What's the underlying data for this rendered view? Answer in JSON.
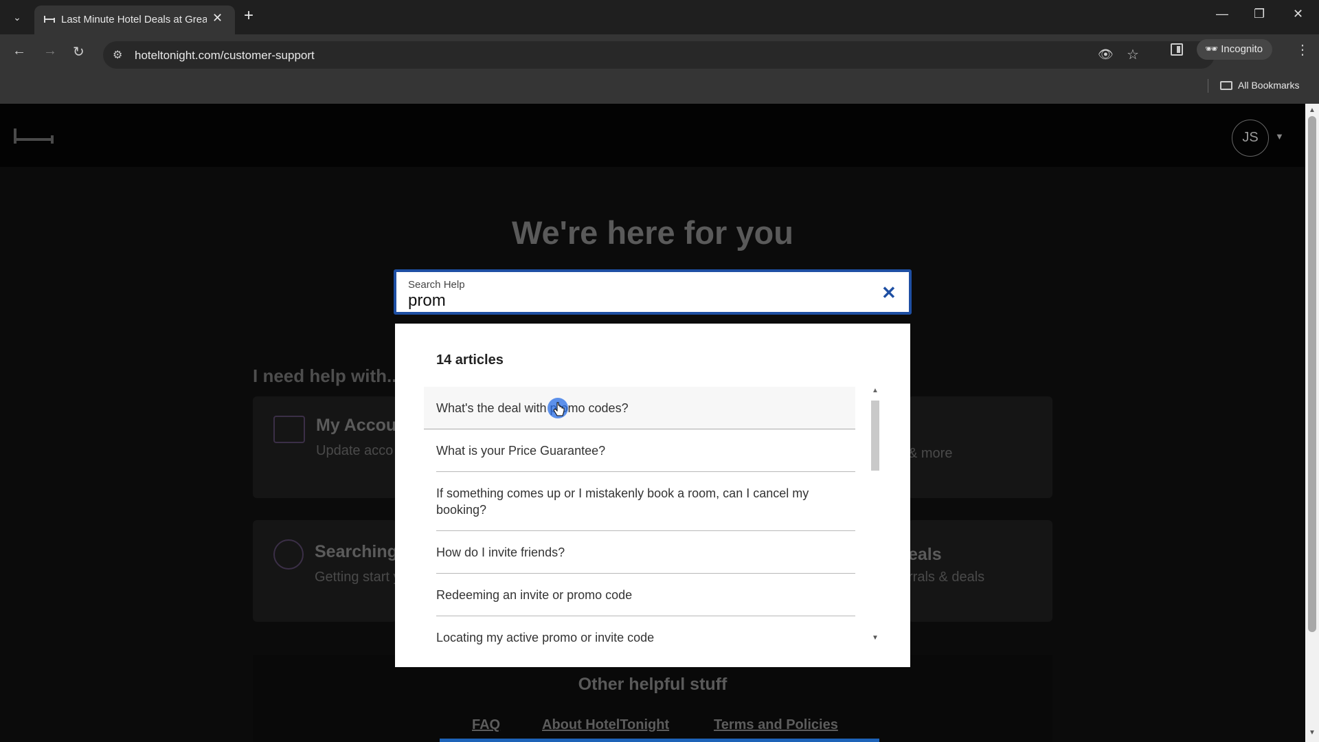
{
  "browser": {
    "tab_title": "Last Minute Hotel Deals at Grea",
    "tab_close": "✕",
    "new_tab": "+",
    "url": "hoteltonight.com/customer-support",
    "profile_label": "Incognito",
    "bookmarks_label": "All Bookmarks"
  },
  "header": {
    "avatar_initials": "JS"
  },
  "hero": {
    "title": "We're here for you"
  },
  "help": {
    "heading": "I need help with...",
    "cards": [
      {
        "title": "My Accou",
        "description": "Update acco & codes, and"
      },
      {
        "title": "Searching",
        "description": "Getting start your booking"
      }
    ],
    "right_fragments": [
      "& more",
      "eals",
      "rrals & deals"
    ]
  },
  "search": {
    "label": "Search Help",
    "value": "prom",
    "clear_icon": "✕"
  },
  "results": {
    "count_label": "14 articles",
    "items": [
      "What's the deal with promo codes?",
      "What is your Price Guarantee?",
      "If something comes up or I mistakenly book a room, can I cancel my booking?",
      "How do I invite friends?",
      "Redeeming an invite or promo code",
      "Locating my active promo or invite code"
    ]
  },
  "footer": {
    "title": "Other helpful stuff",
    "links": [
      "FAQ",
      "About HotelTonight",
      "Terms and Policies"
    ]
  },
  "colors": {
    "accent_blue": "#1e4fa3",
    "page_background": "#0b0b0b",
    "chrome_dark": "#1f1f1f"
  }
}
